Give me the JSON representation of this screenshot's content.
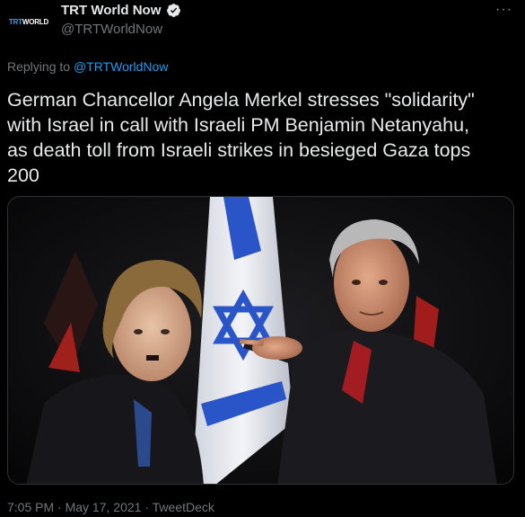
{
  "tweet": {
    "display_name": "TRT World Now",
    "handle": "@TRTWorldNow",
    "avatar_text_trt": "TRT",
    "avatar_text_world": "WORLD",
    "more_label": "···",
    "replying_prefix": "Replying to",
    "replying_handle": "@TRTWorldNow",
    "text": "German Chancellor Angela Merkel stresses \"solidarity\"\nwith Israel in call with Israeli PM Benjamin Netanyahu,\nas death toll from Israeli strikes in besieged Gaza tops\n200",
    "time": "7:05 PM",
    "sep1": " · ",
    "date": "May 17, 2021",
    "sep2": " · ",
    "source": "TweetDeck"
  },
  "colors": {
    "background": "#000000",
    "link": "#1d9bf0",
    "muted": "#71767b",
    "verified": "#1d9bf0"
  },
  "icons": {
    "verified": "verified-badge-icon",
    "more": "more-options-icon"
  }
}
